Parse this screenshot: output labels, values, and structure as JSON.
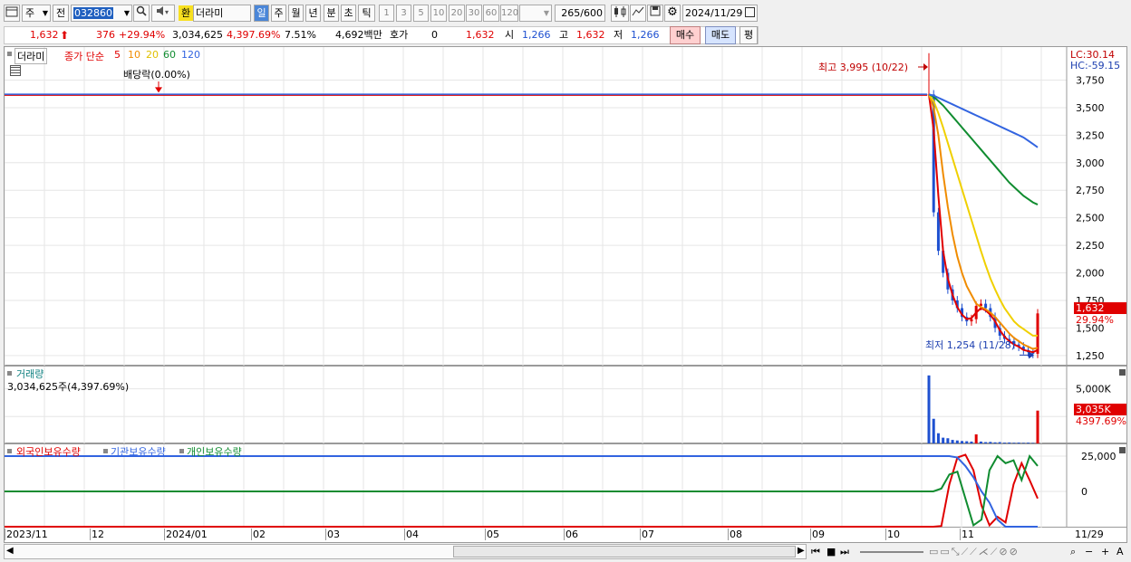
{
  "toolbar": {
    "type_label": "주",
    "prev_label": "전",
    "code_value": "032860",
    "stock_name": "더라미",
    "exchange_label": "환",
    "period_labels": [
      "일",
      "주",
      "월",
      "년",
      "분",
      "초",
      "틱"
    ],
    "tick_numbers": [
      "1",
      "3",
      "5",
      "10",
      "20",
      "30",
      "60",
      "120"
    ],
    "count_value": "265",
    "count_total": "/600",
    "date_value": "2024/11/29"
  },
  "quote": {
    "price": "1,632",
    "change": "376",
    "change_pct": "+29.94%",
    "volume": "3,034,625",
    "volume_pct": "4,397.69%",
    "turnover": "7.51%",
    "amount": "4,692백만",
    "hoga_label": "호가",
    "hoga_value": "0",
    "ask_price": "1,632",
    "open_label": "시",
    "open_value": "1,266",
    "high_label": "고",
    "high_value": "1,632",
    "low_label": "저",
    "low_value": "1,266",
    "buy_label": "매수",
    "sell_label": "매도",
    "eval_label": "평"
  },
  "price_panel": {
    "legend_name": "더라미",
    "legend_text": "종가 단순",
    "ma_labels": [
      "5",
      "10",
      "20",
      "60",
      "120"
    ],
    "ma_colors": [
      "#e00000",
      "#f08c00",
      "#f0d000",
      "#108c30",
      "#3264e0"
    ],
    "dividend_label": "배당락(0.00%)",
    "high_label": "최고 3,995 (10/22)",
    "low_label": "최저 1,254 (11/28)",
    "lc_label": "LC:30.14",
    "hc_label": "HC:-59.15",
    "current_price_tag": "1,632",
    "current_pct_tag": "29.94%"
  },
  "volume_panel": {
    "title": "거래량",
    "value_text": "3,034,625주(4,397.69%)",
    "current_tag": "3,035K",
    "current_pct": "4397.69%"
  },
  "holdings_panel": {
    "legend": [
      "외국인보유수량",
      "기관보유수량",
      "개인보유수량"
    ],
    "legend_colors": [
      "#e00000",
      "#3264e0",
      "#108c30"
    ]
  },
  "x_axis": [
    "2023/11",
    "12",
    "2024/01",
    "02",
    "03",
    "04",
    "05",
    "06",
    "07",
    "08",
    "09",
    "10",
    "11",
    "11/29"
  ],
  "chart_data": [
    {
      "type": "line",
      "title": "더라미 일봉",
      "y_ticks": [
        "3,750",
        "3,500",
        "3,250",
        "3,000",
        "2,750",
        "2,500",
        "2,250",
        "2,000",
        "1,750",
        "1,500",
        "1,250"
      ],
      "ylim": [
        1150,
        4050
      ],
      "flat_price": 3620,
      "high": 3995,
      "low": 1254,
      "last": 1632,
      "candles_close": [
        3620,
        2550,
        2200,
        2000,
        1850,
        1750,
        1680,
        1600,
        1560,
        1580,
        1700,
        1720,
        1680,
        1600,
        1500,
        1430,
        1400,
        1380,
        1350,
        1330,
        1300,
        1280,
        1266,
        1632
      ],
      "ma_series": [
        {
          "name": "5",
          "values": [
            3620,
            3300,
            2700,
            2200,
            1950,
            1800,
            1690,
            1620,
            1580,
            1590,
            1640,
            1680,
            1660,
            1620,
            1560,
            1480,
            1420,
            1380,
            1350,
            1330,
            1300,
            1290,
            1280,
            1300
          ]
        },
        {
          "name": "10",
          "values": [
            3620,
            3500,
            3250,
            2900,
            2600,
            2350,
            2150,
            2000,
            1880,
            1800,
            1720,
            1690,
            1670,
            1640,
            1600,
            1550,
            1500,
            1450,
            1410,
            1380,
            1350,
            1330,
            1310,
            1320
          ]
        },
        {
          "name": "20",
          "values": [
            3620,
            3560,
            3450,
            3320,
            3180,
            3040,
            2900,
            2760,
            2620,
            2480,
            2340,
            2200,
            2070,
            1950,
            1850,
            1760,
            1680,
            1620,
            1560,
            1520,
            1490,
            1460,
            1430,
            1430
          ]
        },
        {
          "name": "60",
          "values": [
            3620,
            3600,
            3560,
            3520,
            3470,
            3420,
            3370,
            3320,
            3270,
            3220,
            3170,
            3120,
            3070,
            3020,
            2970,
            2920,
            2870,
            2820,
            2780,
            2740,
            2700,
            2670,
            2640,
            2620
          ]
        },
        {
          "name": "120",
          "values": [
            3620,
            3610,
            3590,
            3570,
            3550,
            3530,
            3510,
            3490,
            3470,
            3450,
            3430,
            3410,
            3390,
            3370,
            3350,
            3330,
            3310,
            3290,
            3270,
            3250,
            3230,
            3200,
            3170,
            3140
          ]
        }
      ]
    },
    {
      "type": "bar",
      "title": "거래량",
      "y_ticks": [
        "5,000K",
        "2,500K"
      ],
      "ylim": [
        0,
        7000
      ],
      "values": [
        6200,
        2300,
        1000,
        600,
        550,
        400,
        350,
        300,
        280,
        250,
        900,
        250,
        200,
        220,
        180,
        200,
        150,
        170,
        140,
        160,
        130,
        150,
        120,
        3035
      ]
    },
    {
      "type": "line",
      "title": "보유수량",
      "y_ticks": [
        "25,000",
        "0"
      ],
      "series": [
        {
          "name": "외국인보유수량",
          "values": [
            -25000,
            -25000,
            -24500,
            5000,
            24000,
            26000,
            15000,
            -10000,
            -24000,
            -18000,
            -22000,
            5000,
            20000,
            8000,
            -5000
          ]
        },
        {
          "name": "기관보유수량",
          "values": [
            25000,
            25000,
            25000,
            25000,
            24000,
            18000,
            10000,
            0,
            -8000,
            -20000,
            -25000,
            -25000,
            -25000,
            -25000,
            -25000
          ]
        },
        {
          "name": "개인보유수량",
          "values": [
            0,
            0,
            2000,
            12000,
            14000,
            -5000,
            -24000,
            -20000,
            15000,
            25000,
            20000,
            22000,
            8000,
            25000,
            18000
          ]
        }
      ]
    }
  ]
}
